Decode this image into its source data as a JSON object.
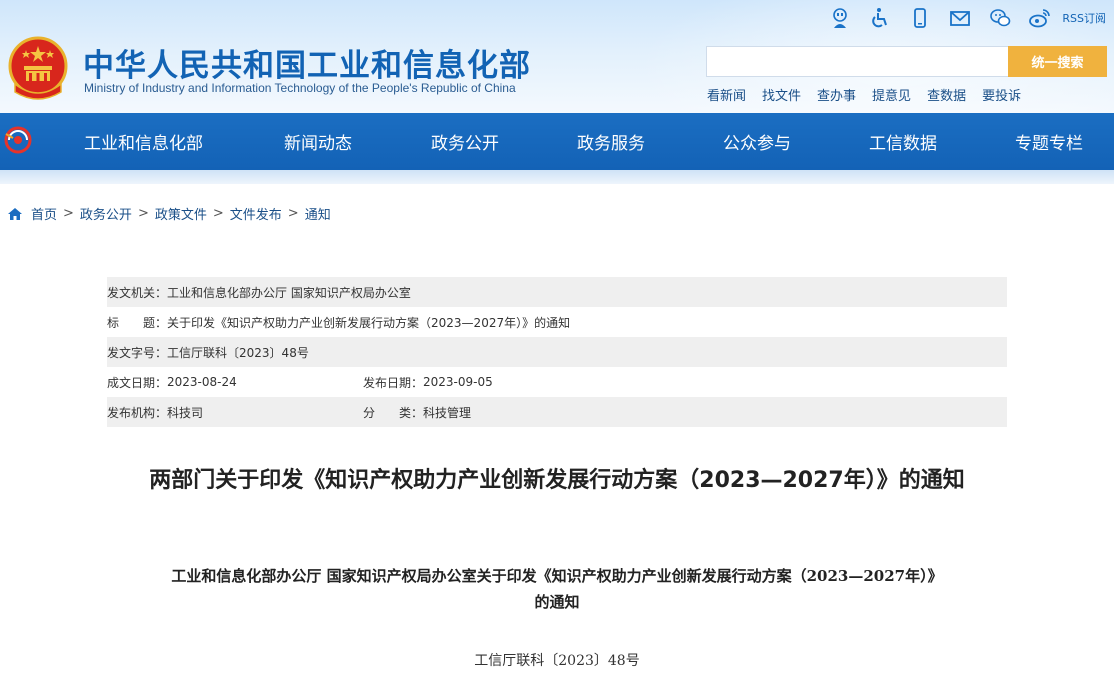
{
  "header": {
    "title": "中华人民共和国工业和信息化部",
    "subtitle": "Ministry of Industry and Information Technology of the People's Republic of China",
    "top_icons": [
      "robot-icon",
      "accessibility-icon",
      "mobile-icon",
      "mail-icon",
      "wechat-icon",
      "weibo-icon"
    ],
    "rss_label": "RSS订阅",
    "search_placeholder": "",
    "search_button": "统一搜索",
    "quick_links": [
      "看新闻",
      "找文件",
      "查办事",
      "提意见",
      "查数据",
      "要投诉"
    ]
  },
  "nav": {
    "items": [
      "工业和信息化部",
      "新闻动态",
      "政务公开",
      "政务服务",
      "公众参与",
      "工信数据",
      "专题专栏"
    ]
  },
  "breadcrumb": {
    "items": [
      "首页",
      "政务公开",
      "政策文件",
      "文件发布",
      "通知"
    ],
    "separator": ">"
  },
  "info": {
    "issuer_label": "发文机关：",
    "issuer": "工业和信息化部办公厅 国家知识产权局办公室",
    "title_label": "标　　题：",
    "title": "关于印发《知识产权助力产业创新发展行动方案（2023—2027年）》的通知",
    "docno_label": "发文字号：",
    "docno": "工信厅联科〔2023〕48号",
    "date_label": "成文日期：",
    "date": "2023-08-24",
    "pubdate_label": "发布日期：",
    "pubdate": "2023-09-05",
    "org_label": "发布机构：",
    "org": "科技司",
    "category_label": "分　　类：",
    "category": "科技管理"
  },
  "article": {
    "title": "两部门关于印发《知识产权助力产业创新发展行动方案（2023—2027年）》的通知",
    "subtitle_line1": "工业和信息化部办公厅 国家知识产权局办公室关于印发《知识产权助力产业创新发展行动方案（2023—2027年）》",
    "subtitle_line2": "的通知",
    "doc_number": "工信厅联科〔2023〕48号"
  },
  "colors": {
    "nav_blue": "#1568bd",
    "title_blue": "#1263b4",
    "search_button": "#f0b23e"
  }
}
